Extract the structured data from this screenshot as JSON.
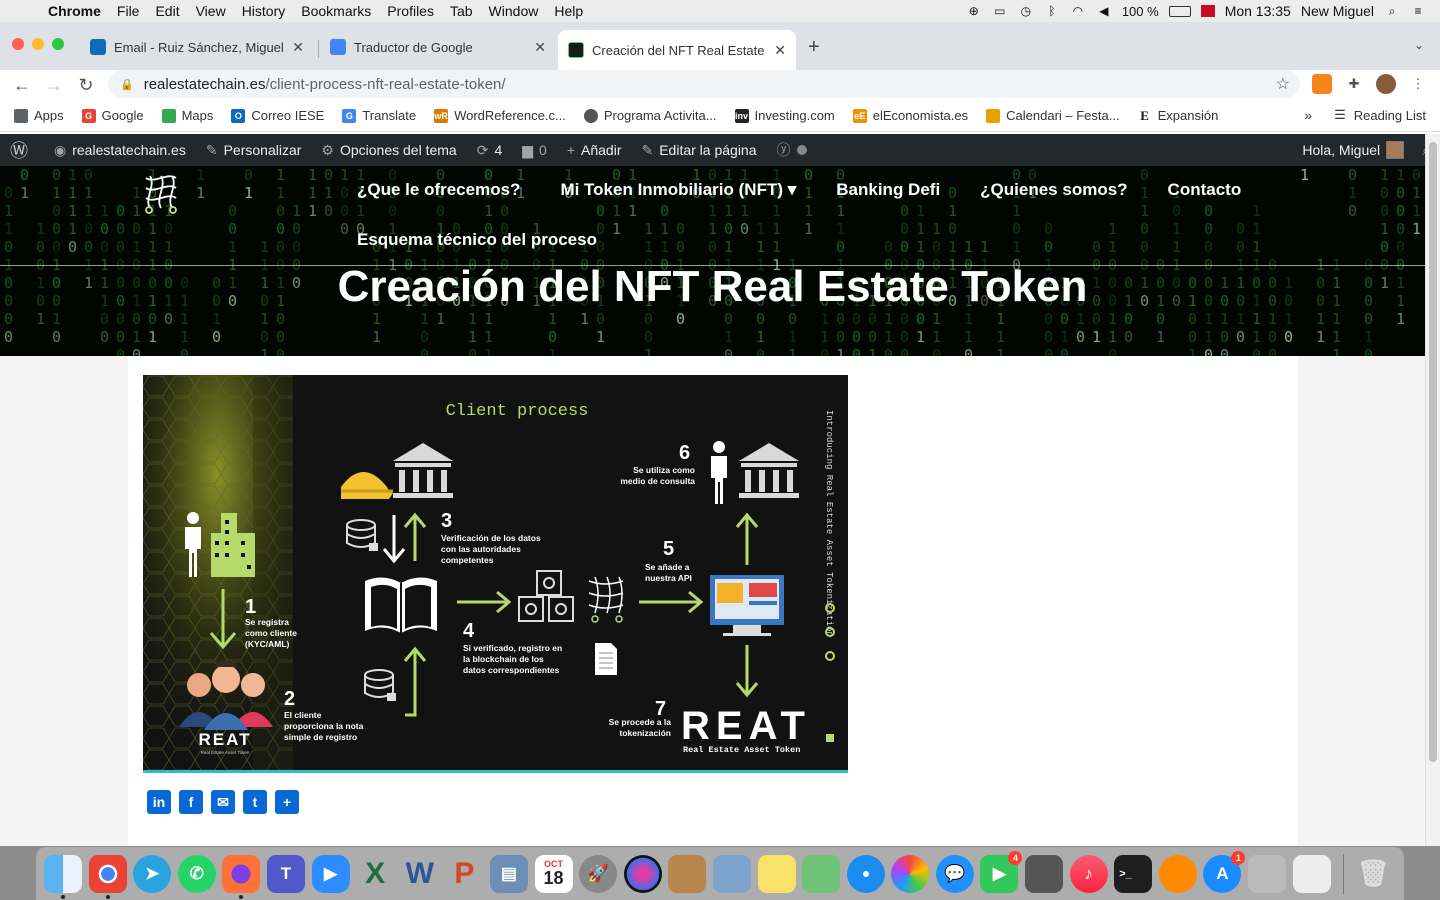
{
  "menubar": {
    "app": "Chrome",
    "items": [
      "File",
      "Edit",
      "View",
      "History",
      "Bookmarks",
      "Profiles",
      "Tab",
      "Window",
      "Help"
    ],
    "battery": "100 %",
    "clock": "Mon 13:35",
    "user": "New Miguel"
  },
  "tabs": [
    {
      "label": "Email - Ruiz Sánchez, Miguel - ",
      "favicon_color": "#0f6cbd"
    },
    {
      "label": "Traductor de Google",
      "favicon_color": "#4285f4"
    },
    {
      "label": "Creación del NFT Real Estate T",
      "favicon_color": "#1a1a1a"
    }
  ],
  "url": {
    "host": "realestatechain.es",
    "path": "/client-process-nft-real-estate-token/"
  },
  "bookmarks": [
    {
      "label": "Apps",
      "icon": "apps-grid-icon",
      "color": "#5f6368"
    },
    {
      "label": "Google",
      "icon": "google-icon",
      "color": "#ea4335"
    },
    {
      "label": "Maps",
      "icon": "maps-pin-icon",
      "color": "#34a853"
    },
    {
      "label": "Correo IESE",
      "icon": "outlook-icon",
      "color": "#0f6cbd"
    },
    {
      "label": "Translate",
      "icon": "translate-icon",
      "color": "#4285f4"
    },
    {
      "label": "WordReference.c...",
      "icon": "wordreference-icon",
      "color": "#d97b00"
    },
    {
      "label": "Programa Activita...",
      "icon": "programa-icon",
      "color": "#555555"
    },
    {
      "label": "Investing.com",
      "icon": "investing-icon",
      "color": "#222222"
    },
    {
      "label": "elEconomista.es",
      "icon": "eleconomista-icon",
      "color": "#f29100"
    },
    {
      "label": "Calendari – Festa...",
      "icon": "calendar-icon",
      "color": "#e6a100"
    },
    {
      "label": "Expansión",
      "icon": "expansion-icon",
      "color": "#111111"
    }
  ],
  "reading_list": "Reading List",
  "wpbar": {
    "site": "realestatechain.es",
    "customize": "Personalizar",
    "theme_options": "Opciones del tema",
    "updates": "4",
    "comments": "0",
    "add_new": "Añadir",
    "edit_page": "Editar la página",
    "greeting": "Hola, Miguel"
  },
  "nav": {
    "items": [
      "¿Que le ofrecemos?",
      "Mi Token Inmobiliario (NFT) ▾",
      "Banking Defi",
      "¿Quienes somos?",
      "Contacto"
    ],
    "second_row": "Esquema técnico del proceso"
  },
  "page_title": "Creación del NFT Real Estate Token",
  "infographic": {
    "title": "Client process",
    "side_text": "Introducing Real Estate Asset Tokenization",
    "steps": [
      {
        "n": "1",
        "text": [
          "Se registra",
          "como cliente",
          "(KYC/AML)"
        ]
      },
      {
        "n": "2",
        "text": [
          "El cliente",
          "proporciona la nota",
          "simple de registro"
        ]
      },
      {
        "n": "3",
        "text": [
          "Verificación de los datos",
          "con las autoridades",
          "competentes"
        ]
      },
      {
        "n": "4",
        "text": [
          "Si verificado, registro en",
          "la blockchain de los",
          "datos correspondientes"
        ]
      },
      {
        "n": "5",
        "text": [
          "Se añade a",
          "nuestra API"
        ]
      },
      {
        "n": "6",
        "text": [
          "Se utiliza como",
          "medio de consulta"
        ]
      },
      {
        "n": "7",
        "text": [
          "Se procede a la",
          "tokenización"
        ]
      }
    ],
    "brand_big": "REAT",
    "brand_sub": "Real Estate Asset Token",
    "brand_small": "REAT",
    "brand_small_sub": "Real Estate Asset Token",
    "accent": "#b5d96b"
  },
  "share_buttons": [
    "in",
    "f",
    "✉",
    "t",
    "+"
  ],
  "dock": {
    "calendar_month": "OCT",
    "calendar_day": "18",
    "facetime_badge": "4",
    "appstore_badge": "1"
  }
}
